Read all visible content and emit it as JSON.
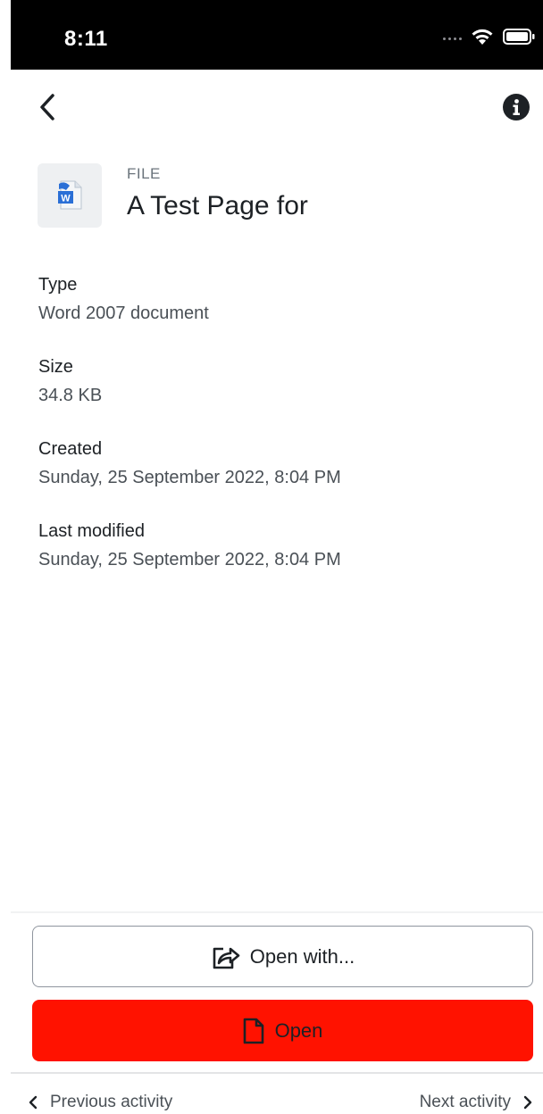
{
  "status_bar": {
    "time": "8:11"
  },
  "file": {
    "kind": "FILE",
    "title": "A Test Page for"
  },
  "details": [
    {
      "label": "Type",
      "value": "Word 2007 document"
    },
    {
      "label": "Size",
      "value": "34.8 KB"
    },
    {
      "label": "Created",
      "value": "Sunday, 25 September 2022, 8:04 PM"
    },
    {
      "label": "Last modified",
      "value": "Sunday, 25 September 2022, 8:04 PM"
    }
  ],
  "actions": {
    "open_with_label": "Open with...",
    "open_label": "Open"
  },
  "footer_nav": {
    "previous_label": "Previous activity",
    "next_label": "Next activity"
  },
  "colors": {
    "open_button": "#ff1200",
    "status_bar_bg": "#000000"
  }
}
